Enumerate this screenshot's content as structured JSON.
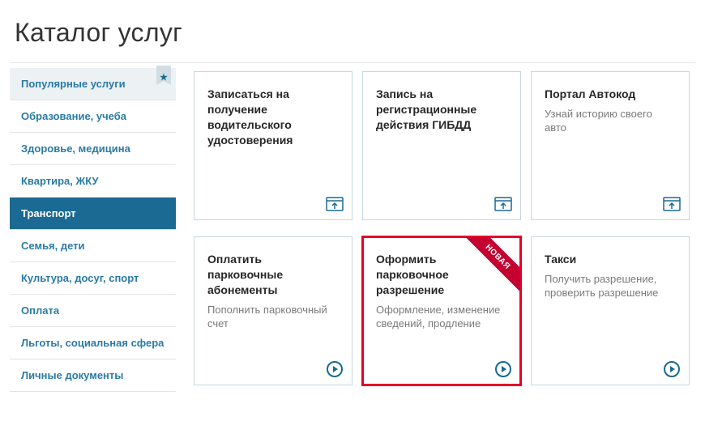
{
  "page": {
    "title": "Каталог услуг"
  },
  "sidebar": {
    "items": [
      {
        "label": "Популярные услуги",
        "popular": true
      },
      {
        "label": "Образование, учеба"
      },
      {
        "label": "Здоровье, медицина"
      },
      {
        "label": "Квартира, ЖКУ"
      },
      {
        "label": "Транспорт",
        "active": true
      },
      {
        "label": "Семья, дети"
      },
      {
        "label": "Культура, досуг, спорт"
      },
      {
        "label": "Оплата"
      },
      {
        "label": "Льготы, социальная сфера"
      },
      {
        "label": "Личные документы"
      }
    ]
  },
  "ribbon": {
    "label": "НОВАЯ"
  },
  "cards": [
    {
      "title": "Записаться на получение водительского удостоверения",
      "desc": "",
      "icon": "window"
    },
    {
      "title": "Запись на регистрационные действия ГИБДД",
      "desc": "",
      "icon": "window"
    },
    {
      "title": "Портал Автокод",
      "desc": "Узнай историю своего авто",
      "icon": "window"
    },
    {
      "title": "Оплатить парковочные абонементы",
      "desc": "Пополнить парковочный счет",
      "icon": "play"
    },
    {
      "title": "Оформить парковочное разрешение",
      "desc": "Оформление, изменение сведений, продление",
      "icon": "play",
      "ribbon": true,
      "highlight": true
    },
    {
      "title": "Такси",
      "desc": "Получить разрешение, проверить разрешение",
      "icon": "play"
    }
  ],
  "colors": {
    "accent": "#1a6a93"
  }
}
